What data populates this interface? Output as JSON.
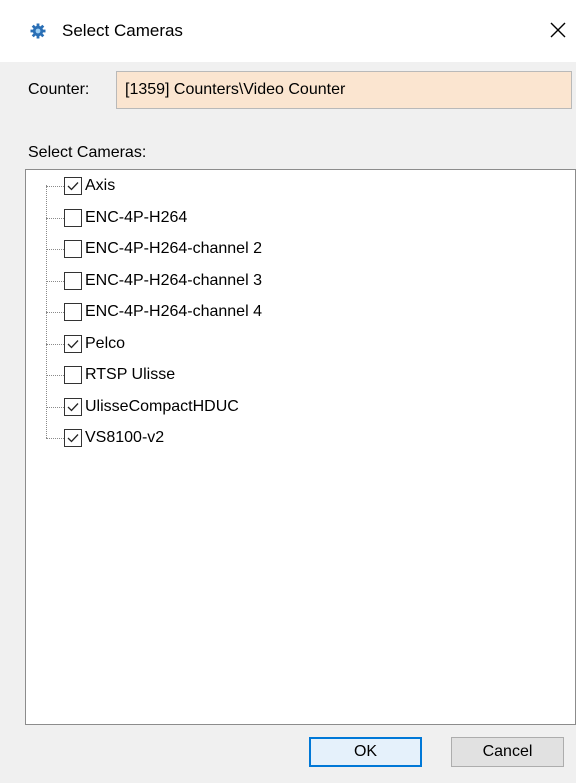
{
  "window": {
    "title": "Select Cameras",
    "icon": "gear-icon",
    "close_icon": "close-icon"
  },
  "counter": {
    "label": "Counter:",
    "value": "[1359] Counters\\Video Counter",
    "field_color": "#fbe5d0"
  },
  "cameras": {
    "label": "Select Cameras:",
    "items": [
      {
        "label": "Axis",
        "checked": true
      },
      {
        "label": "ENC-4P-H264",
        "checked": false
      },
      {
        "label": "ENC-4P-H264-channel 2",
        "checked": false
      },
      {
        "label": "ENC-4P-H264-channel 3",
        "checked": false
      },
      {
        "label": "ENC-4P-H264-channel 4",
        "checked": false
      },
      {
        "label": "Pelco",
        "checked": true
      },
      {
        "label": "RTSP Ulisse",
        "checked": false
      },
      {
        "label": "UlisseCompactHDUC",
        "checked": true
      },
      {
        "label": "VS8100-v2",
        "checked": true
      }
    ]
  },
  "buttons": {
    "ok_label": "OK",
    "cancel_label": "Cancel",
    "accent_color": "#0078d7"
  }
}
